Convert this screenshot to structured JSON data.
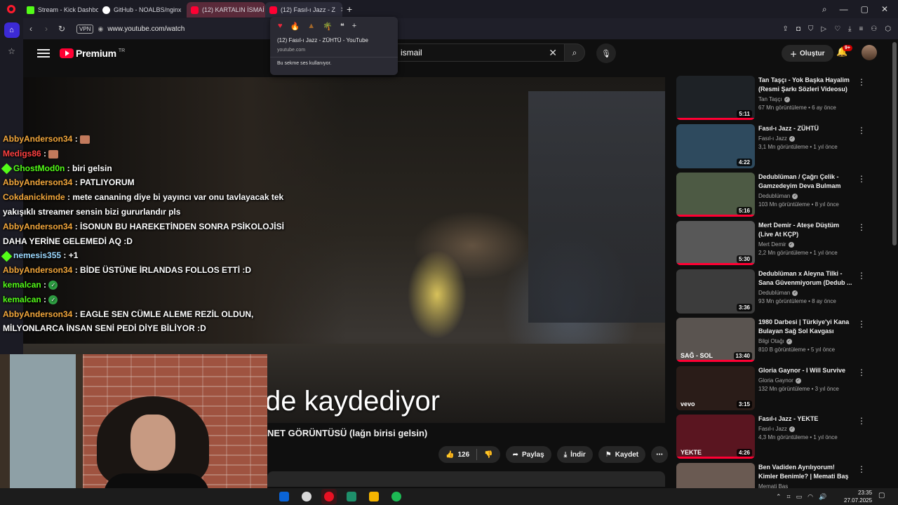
{
  "browser": {
    "tabs": [
      {
        "label": "Stream - Kick Dashboard",
        "icon": "kick-icon"
      },
      {
        "label": "GitHub - NOALBS/nginx-",
        "icon": "github-icon"
      },
      {
        "label": "(12) KARTALIN İSMAİ",
        "icon": "youtube-icon"
      },
      {
        "label": "(12) Fasıl-ı Jazz - Z",
        "icon": "youtube-icon"
      }
    ],
    "new_tab": "+",
    "vpn_label": "VPN",
    "url": "www.youtube.com/watch"
  },
  "tab_popup": {
    "title": "(12) Fasıl-ı Jazz - ZÜHTÜ - YouTube",
    "domain": "youtube.com",
    "note": "Bu sekme ses kullanıyor."
  },
  "youtube": {
    "logo_text": "Premium",
    "logo_tm": "TR",
    "search_value": "ismail",
    "create_label": "Oluştur",
    "notification_badge": "9+",
    "video_caption": "de kaydediyor",
    "video_title": "NET GÖRÜNTÜSÜ (lağn birisi gelsin)",
    "like_count": "126",
    "share_label": "Paylaş",
    "download_label": "İndir",
    "save_label": "Kaydet"
  },
  "chat": [
    {
      "user": "AbbyAnderson34",
      "color": "#f4a83c",
      "message": "",
      "emote": "face-emote"
    },
    {
      "user": "Medigs86",
      "color": "#ff4040",
      "message": "",
      "emote": "face-emote"
    },
    {
      "user": "GhostMod0n",
      "color": "#53fc18",
      "message": "biri gelsin",
      "badge": true
    },
    {
      "user": "AbbyAnderson34",
      "color": "#f4a83c",
      "message": "PATLIYORUM"
    },
    {
      "user": "Cokdanickimde",
      "color": "#f4a83c",
      "message": "mete cananing diye bi yayıncı var onu tavlayacak tek yakışıklı streamer sensin bizi gururlandır pls"
    },
    {
      "user": "AbbyAnderson34",
      "color": "#f4a83c",
      "message": "İSONUN BU HAREKETİNDEN SONRA PSİKOLOJİSİ DAHA YERİNE GELEMEDİ AQ :D"
    },
    {
      "user": "nemesis355",
      "color": "#9bd8ff",
      "message": "+1",
      "badge": true
    },
    {
      "user": "AbbyAnderson34",
      "color": "#f4a83c",
      "message": "BİDE ÜSTÜNE İRLANDAS FOLLOS ETTİ :D"
    },
    {
      "user": "kemalcan",
      "color": "#53fc18",
      "message": "",
      "emote": "check-emote"
    },
    {
      "user": "kemalcan",
      "color": "#53fc18",
      "message": "",
      "emote": "check-emote"
    },
    {
      "user": "AbbyAnderson34",
      "color": "#f4a83c",
      "message": "EAGLE SEN CÜMLE ALEME REZİL OLDUN, MİLYONLARCA İNSAN SENİ PEDİ DİYE BİLİYOR :D"
    }
  ],
  "recommendations": [
    {
      "title": "Tan Taşçı - Yok Başka Hayalim (Resmi Şarkı Sözleri Videosu)",
      "channel": "Tan Taşçı",
      "stats": "67 Mn görüntüleme • 6 ay önce",
      "duration": "5:11",
      "thumb": "#1e2226",
      "watched": 1.0
    },
    {
      "title": "Fasıl-ı Jazz - ZÜHTÜ",
      "channel": "Fasıl-ı Jazz",
      "stats": "3,1 Mn görüntüleme • 1 yıl önce",
      "duration": "4:22",
      "thumb": "#2e4a5e",
      "watched": 0.0
    },
    {
      "title": "Dedublüman / Çağrı Çelik - Gamzedeyim Deva Bulmam",
      "channel": "Dedublüman",
      "stats": "103 Mn görüntüleme • 8 yıl önce",
      "duration": "5:16",
      "thumb": "#4d5a44",
      "watched": 1.0
    },
    {
      "title": "Mert Demir - Ateşe Düştüm (Live At KÇP)",
      "channel": "Mert Demir",
      "stats": "2,2 Mn görüntüleme • 1 yıl önce",
      "duration": "5:30",
      "thumb": "#585858",
      "watched": 1.0
    },
    {
      "title": "Dedublüman x Aleyna Tilki - Sana Güvenmiyorum (Dedub ...",
      "channel": "Dedublüman",
      "stats": "93 Mn görüntüleme • 8 ay önce",
      "duration": "3:36",
      "thumb": "#3c3c3c",
      "watched": 0.0
    },
    {
      "title": "1980 Darbesi | Türkiye'yi Kana Bulayan Sağ Sol Kavgası",
      "channel": "Bilgi Otağı",
      "stats": "810 B görüntüleme • 5 yıl önce",
      "duration": "13:40",
      "thumb": "#5a5450",
      "watched": 1.0,
      "overlay": "SAĞ - SOL"
    },
    {
      "title": "Gloria Gaynor - I Will Survive",
      "channel": "Gloria Gaynor",
      "stats": "132 Mn görüntüleme • 3 yıl önce",
      "duration": "3:15",
      "thumb": "#2a1c18",
      "watched": 0.0,
      "overlay": "vevo"
    },
    {
      "title": "Fasıl-ı Jazz - YEKTE",
      "channel": "Fasıl-ı Jazz",
      "stats": "4,3 Mn görüntüleme • 1 yıl önce",
      "duration": "4:26",
      "thumb": "#5a1520",
      "watched": 1.0,
      "overlay": "YEKTE"
    },
    {
      "title": "Ben Vadiden Ayrılıyorum! Kimler Benimle? | Memati Baş (Kurtla...",
      "channel": "Memati Baş",
      "stats": "",
      "duration": "",
      "thumb": "#6a5a52",
      "watched": 0.0
    }
  ],
  "taskbar": {
    "time": "23:35",
    "date": "27.07.2025",
    "apps": [
      "#0a64d8",
      "#d8d8d8",
      "#e81123",
      "#1e8f6a",
      "#f4b400",
      "#1db954"
    ]
  }
}
